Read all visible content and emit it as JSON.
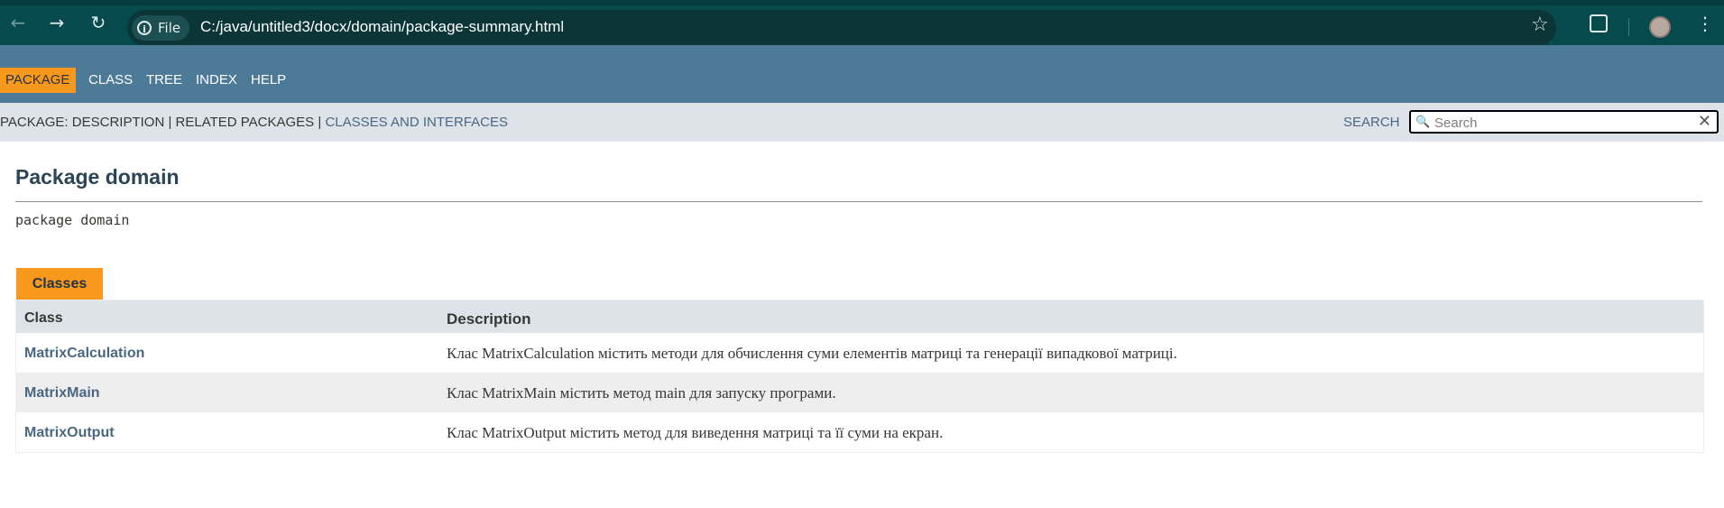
{
  "browser": {
    "url": "C:/java/untitled3/docx/domain/package-summary.html",
    "site_info_label": "File",
    "icons": [
      "back-arrow-icon",
      "forward-arrow-icon",
      "reload-icon",
      "info-icon",
      "star-icon",
      "extensions-icon",
      "avatar",
      "kebab-menu-icon"
    ]
  },
  "topnav": {
    "items": [
      "PACKAGE",
      "CLASS",
      "TREE",
      "INDEX",
      "HELP"
    ],
    "active": "PACKAGE"
  },
  "subnav": {
    "package_label": "PACKAGE:",
    "description_link": "DESCRIPTION",
    "separator": "|",
    "related_label": "RELATED PACKAGES",
    "classes_link": "CLASSES AND INTERFACES",
    "search_label": "SEARCH",
    "search_placeholder": "Search"
  },
  "content": {
    "title": "Package domain",
    "declaration": "package domain",
    "tab_label": "Classes",
    "table": {
      "headers": [
        "Class",
        "Description"
      ],
      "rows": [
        {
          "name": "MatrixCalculation",
          "description": "Клас MatrixCalculation містить методи для обчислення суми елементів матриці та генерації випадкової матриці."
        },
        {
          "name": "MatrixMain",
          "description": "Клас MatrixMain містить метод main для запуску програми."
        },
        {
          "name": "MatrixOutput",
          "description": "Клас MatrixOutput містить метод для виведення матриці та її суми на екран."
        }
      ]
    }
  },
  "colors": {
    "chrome": "#074a4d",
    "topnav": "#4d7a97",
    "accent": "#f8981d",
    "subnav": "#dee3e9",
    "link": "#4a6782"
  }
}
